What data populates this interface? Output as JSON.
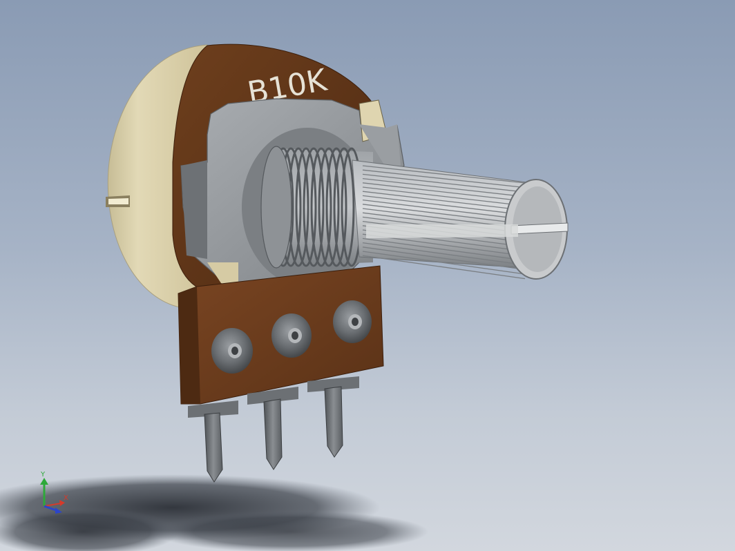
{
  "viewport": {
    "background_top": "#8a9bb4",
    "background_bottom": "#d2d7de"
  },
  "model": {
    "marking": "B10K",
    "body_color": "#ddd3ac",
    "rim_color": "#5e3418",
    "metal_color": "#8f9397",
    "pcb_color": "#6b3e1e"
  },
  "triad": {
    "y_label": "Y",
    "x_label": "X",
    "y_color": "#2ea93a",
    "x_color": "#d63a2a",
    "z_color": "#2c45c9"
  }
}
